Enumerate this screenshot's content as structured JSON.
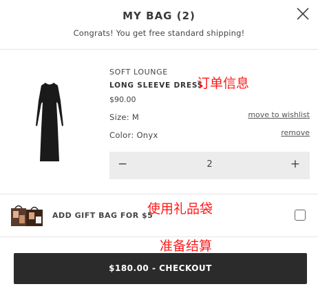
{
  "header": {
    "title": "MY BAG (2)",
    "subtitle": "Congrats! You get free standard shipping!",
    "close_icon": "close-icon"
  },
  "item": {
    "brand": "SOFT LOUNGE",
    "name": "LONG SLEEVE DRESS",
    "price": "$90.00",
    "size": "Size: M",
    "color": "Color: Onyx",
    "move_to_wishlist": "move to wishlist",
    "remove": "remove",
    "quantity": "2",
    "minus": "−",
    "plus": "+",
    "annotation": "订单信息"
  },
  "gift": {
    "label": "ADD GIFT BAG FOR $5",
    "checked": false,
    "annotation": "使用礼品袋"
  },
  "checkout": {
    "label": "$180.00 - CHECKOUT",
    "annotation": "准备结算"
  },
  "colors": {
    "annotation": "#ff1a1a",
    "checkout_bg": "#2b2b2b"
  }
}
